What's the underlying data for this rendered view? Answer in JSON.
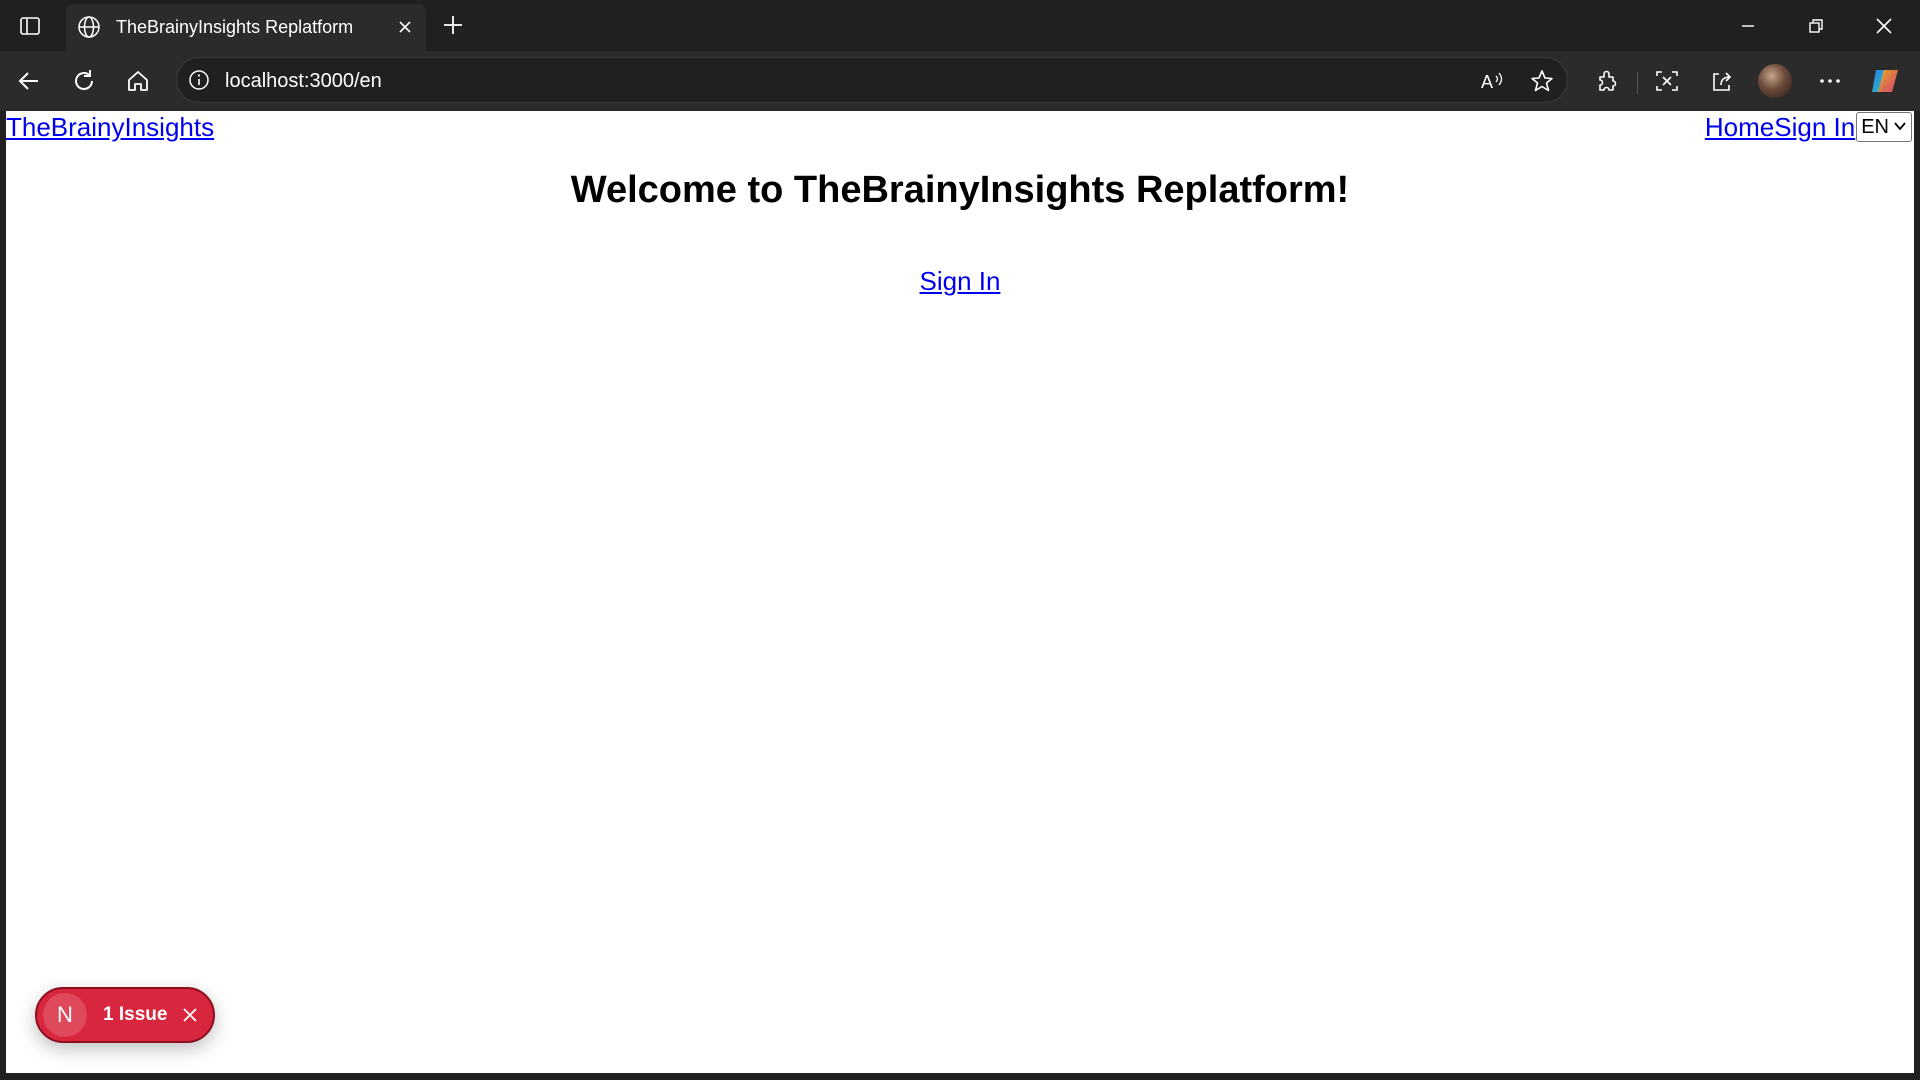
{
  "browser": {
    "tab_title": "TheBrainyInsights Replatform",
    "url": "localhost:3000/en",
    "icons": [
      "sidebar-toggle-icon",
      "globe-icon",
      "close-icon",
      "plus-icon",
      "minimize-icon",
      "restore-icon",
      "close-window-icon",
      "back-icon",
      "refresh-icon",
      "home-icon",
      "info-icon",
      "read-aloud-icon",
      "favorite-star-icon",
      "extensions-icon",
      "screenshot-icon",
      "share-icon",
      "more-icon",
      "copilot-icon"
    ]
  },
  "page": {
    "logo_text": "TheBrainyInsights",
    "nav": {
      "home_label": "Home",
      "signin_label": "Sign In",
      "language_selected": "EN"
    },
    "welcome_heading": "Welcome to TheBrainyInsights Replatform!",
    "signin_link": "Sign In"
  },
  "dev_overlay": {
    "badge_letter": "N",
    "issue_label": "1 Issue",
    "color": "#d7263d"
  }
}
